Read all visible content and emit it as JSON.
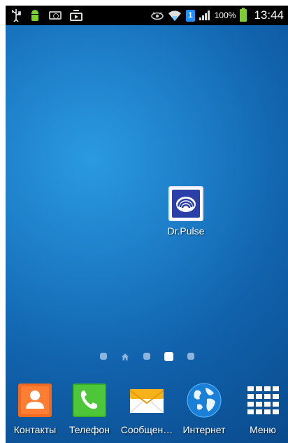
{
  "status_bar": {
    "battery_percent": "100%",
    "time": "13:44",
    "sim_badge": "1",
    "notification_icons": [
      "usb-icon",
      "android-battery-icon",
      "camera-icon",
      "tv-play-icon"
    ],
    "system_icons": [
      "eye-icon",
      "wifi-icon",
      "sim-icon",
      "signal-icon",
      "battery-icon"
    ]
  },
  "desktop": {
    "shortcuts": [
      {
        "label": "Dr.Pulse",
        "icon": "dr-pulse-app-icon"
      }
    ]
  },
  "pager": {
    "pages": 5,
    "active_index": 3,
    "home_index": 1
  },
  "dock": {
    "items": [
      {
        "label": "Контакты",
        "icon": "contacts-icon",
        "color": "#f26a1f"
      },
      {
        "label": "Телефон",
        "icon": "phone-icon",
        "color": "#3aae2a"
      },
      {
        "label": "Сообщен…",
        "icon": "messages-icon",
        "color": "#f5b21b"
      },
      {
        "label": "Интернет",
        "icon": "globe-icon",
        "color": "#1a7fd6"
      },
      {
        "label": "Меню",
        "icon": "apps-grid-icon",
        "color": "#ffffff"
      }
    ]
  }
}
